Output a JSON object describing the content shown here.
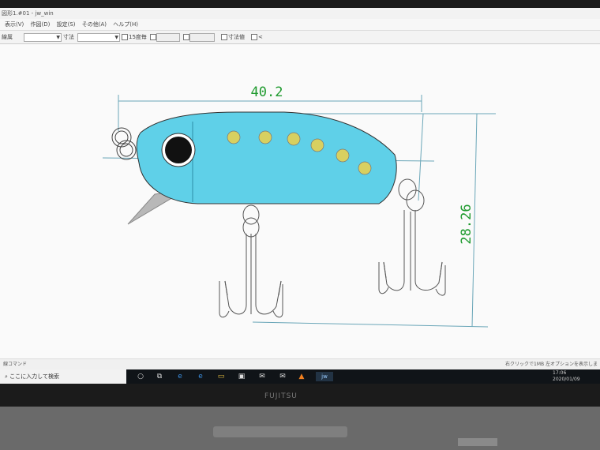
{
  "window": {
    "title": "図形1.#01 - jw_win"
  },
  "menu": {
    "items": [
      "表示(V)",
      "作図(D)",
      "設定(S)",
      "その他(A)",
      "ヘルプ(H)"
    ]
  },
  "toolbar": {
    "label_layer": "線属",
    "label_linetype": "線色",
    "label_size": "寸法",
    "check_15": "15度毎",
    "check_size_value": "寸法値",
    "check_arrow": "<"
  },
  "drawing": {
    "dim_width": "40.2",
    "dim_height": "28.26",
    "colors": {
      "body": "#5fd0e8",
      "dots": "#d8d060",
      "dimension_text": "#1e9a2e",
      "dimension_line": "#6aa6b8",
      "outline": "#333333"
    }
  },
  "statusbar": {
    "left_text": "線コマンド",
    "right_text": "右クリックで1MB 左オプションを表示します"
  },
  "taskbar": {
    "search_placeholder": "ここに入力して検索",
    "icons": [
      "circle-icon",
      "task-view-icon",
      "edge-icon",
      "ie-icon",
      "folder-icon",
      "store-icon",
      "mail-icon",
      "vlc-icon",
      "jw-icon"
    ],
    "time": "17:06",
    "date": "2020/01/09"
  },
  "bezel": {
    "brand": "FUJITSU"
  }
}
